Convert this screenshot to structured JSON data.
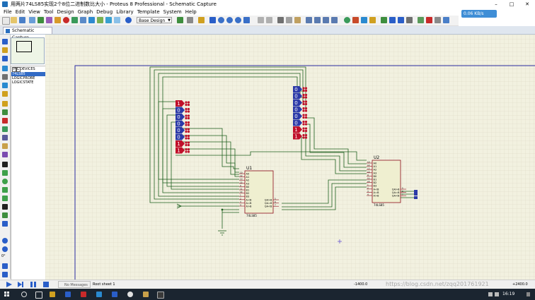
{
  "window": {
    "title": "用两片74LS85实现2个8位二进制数比大小 - Proteus 8 Professional - Schematic Capture",
    "min": "–",
    "max": "□",
    "close": "✕"
  },
  "menu": [
    "File",
    "Edit",
    "View",
    "Tool",
    "Design",
    "Graph",
    "Debug",
    "Library",
    "Template",
    "System",
    "Help"
  ],
  "toolbar": {
    "design_select": "Base Design",
    "net_speed": "0.06 KB/s"
  },
  "tab": {
    "label": "Schematic Capture"
  },
  "devices": {
    "p_label": "P",
    "l_label": "L",
    "header": "DEVICES",
    "items": [
      "74LS85",
      "LOGICPROBE",
      "LOGICSTATE"
    ],
    "selected": 0
  },
  "left_tools": {
    "rotation": "0°"
  },
  "schematic": {
    "u1": {
      "ref": "U1",
      "part": "74LS85",
      "left_pins": [
        "A0",
        "A1",
        "A2",
        "A3",
        "B0",
        "B1",
        "B2",
        "B3",
        "A<B",
        "A=B",
        "A>B"
      ],
      "left_nums": [
        "10",
        "12",
        "13",
        "15",
        "9",
        "11",
        "14",
        "1",
        "2",
        "3",
        "4"
      ],
      "right_pins": [
        "QA>B",
        "QA=B",
        "QA<B"
      ],
      "right_nums": [
        "5",
        "6",
        "7"
      ]
    },
    "u2": {
      "ref": "U2",
      "part": "74LS85",
      "left_pins": [
        "A0",
        "A1",
        "A2",
        "A3",
        "B0",
        "B1",
        "B2",
        "B3",
        "A<B",
        "A=B",
        "A>B"
      ],
      "left_nums": [
        "10",
        "12",
        "13",
        "15",
        "9",
        "11",
        "14",
        "1",
        "2",
        "3",
        "4"
      ],
      "right_pins": [
        "QA>B",
        "QA=B",
        "QA<B"
      ],
      "right_nums": [
        "5",
        "6",
        "7"
      ]
    },
    "state_group_a": {
      "values": [
        "1",
        "0",
        "0",
        "0",
        "0",
        "0",
        "1",
        "1"
      ]
    },
    "state_group_b": {
      "values": [
        "0",
        "0",
        "0",
        "0",
        "0",
        "0",
        "1",
        "1"
      ]
    }
  },
  "statusbar": {
    "messages": "No Messages",
    "sheet": "Root sheet 1",
    "coord_x": "-1400.0",
    "coord_y": "+2400.0"
  },
  "watermark": "https://blog.csdn.net/zqq201761921",
  "taskbar": {
    "time": "16:19"
  },
  "colors": {
    "grid_bg": "#f2f1e0",
    "grid_line": "#d8d6c2",
    "wire": "#1c5e1c",
    "component_fill": "#efefd0",
    "component_border": "#8b0a1a",
    "state_high": "#c0102a",
    "state_low": "#2c3aa8",
    "sheet_border": "#2a2aa0"
  }
}
